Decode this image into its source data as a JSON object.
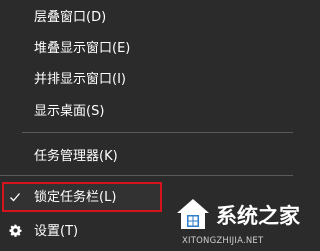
{
  "context_menu": {
    "items": [
      {
        "label": "层叠窗口(D)"
      },
      {
        "label": "堆叠显示窗口(E)"
      },
      {
        "label": "并排显示窗口(I)"
      },
      {
        "label": "显示桌面(S)"
      },
      {
        "label": "任务管理器(K)"
      },
      {
        "label": "锁定任务栏(L)",
        "checked": true
      },
      {
        "label": "设置(T)"
      }
    ]
  },
  "watermark": {
    "title": "系统之家",
    "url": "XITONGZHIJIA.NET"
  },
  "colors": {
    "menu_background": "#2b2b2b",
    "text": "#ffffff",
    "separator": "#5a5a5a",
    "highlight_border": "#d6141c"
  },
  "icons": {
    "checked_item": "checkmark-icon",
    "settings_item": "gear-icon",
    "watermark_logo": "house-logo-icon"
  }
}
